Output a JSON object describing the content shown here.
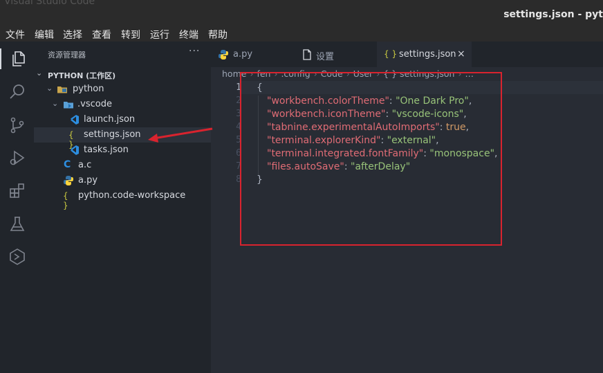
{
  "window": {
    "title": "settings.json - pyt",
    "faint_title": "Visual Studio Code"
  },
  "menu": [
    "文件",
    "编辑",
    "选择",
    "查看",
    "转到",
    "运行",
    "终端",
    "帮助"
  ],
  "activity_bar": [
    "files-icon",
    "search-icon",
    "source-control-icon",
    "run-debug-icon",
    "extensions-icon",
    "testing-icon",
    "remote-icon"
  ],
  "sidebar": {
    "header": "资源管理器",
    "more": "···",
    "workspace": "PYTHON (工作区)",
    "tree": [
      {
        "label": "python",
        "icon": "folder-python-icon"
      },
      {
        "label": ".vscode",
        "icon": "folder-vscode-icon"
      },
      {
        "label": "launch.json",
        "icon": "vscode-icon"
      },
      {
        "label": "settings.json",
        "icon": "json-braces-icon"
      },
      {
        "label": "tasks.json",
        "icon": "vscode-icon"
      },
      {
        "label": "a.c",
        "icon": "c-icon"
      },
      {
        "label": "a.py",
        "icon": "python-icon"
      },
      {
        "label": "python.code-workspace",
        "icon": "json-braces-icon"
      }
    ]
  },
  "tabs": [
    {
      "label": "a.py",
      "icon": "python-icon"
    },
    {
      "label": "设置",
      "icon": "file-icon"
    },
    {
      "label": "settings.json",
      "icon": "json-braces-icon",
      "active": true,
      "close": "×"
    }
  ],
  "breadcrumbs": [
    "home",
    "fen",
    ".config",
    "Code",
    "User",
    "{ } settings.json",
    "…"
  ],
  "line_numbers": [
    "1",
    "2",
    "3",
    "4",
    "5",
    "6",
    "7",
    "8"
  ],
  "code": {
    "open": "{",
    "close": "}",
    "entries": [
      {
        "key": "\"workbench.colorTheme\"",
        "value": "\"One Dark Pro\"",
        "comma": ","
      },
      {
        "key": "\"workbench.iconTheme\"",
        "value": "\"vscode-icons\"",
        "comma": ","
      },
      {
        "key": "\"tabnine.experimentalAutoImports\"",
        "value": "true",
        "comma": ","
      },
      {
        "key": "\"terminal.explorerKind\"",
        "value": "\"external\"",
        "comma": ","
      },
      {
        "key": "\"terminal.integrated.fontFamily\"",
        "value": "\"monospace\"",
        "comma": ","
      },
      {
        "key": "\"files.autoSave\"",
        "value": "\"afterDelay\"",
        "comma": ""
      }
    ]
  },
  "colors": {
    "annotation": "#d9232e",
    "json_key": "#e06c75",
    "json_string": "#98c379",
    "json_bool": "#d19a66"
  }
}
